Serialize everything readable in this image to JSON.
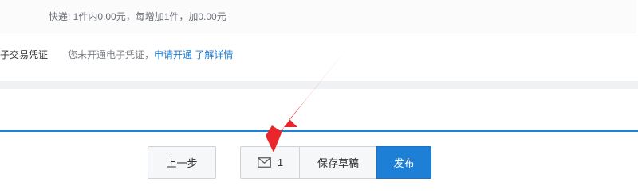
{
  "shipping": {
    "text": "快递: 1件内0.00元，每增加1件，加0.00元"
  },
  "voucher": {
    "label": "子交易凭证",
    "note": "您未开通电子凭证，",
    "apply_link": "申请开通",
    "details_link": "了解详情"
  },
  "footer": {
    "prev_label": "上一步",
    "message_icon": "mail-icon",
    "message_count": "1",
    "save_draft_label": "保存草稿",
    "publish_label": "发布"
  },
  "colors": {
    "accent": "#1e7fd6",
    "link": "#1d7bd3",
    "annotation_arrow": "#e8262b"
  }
}
